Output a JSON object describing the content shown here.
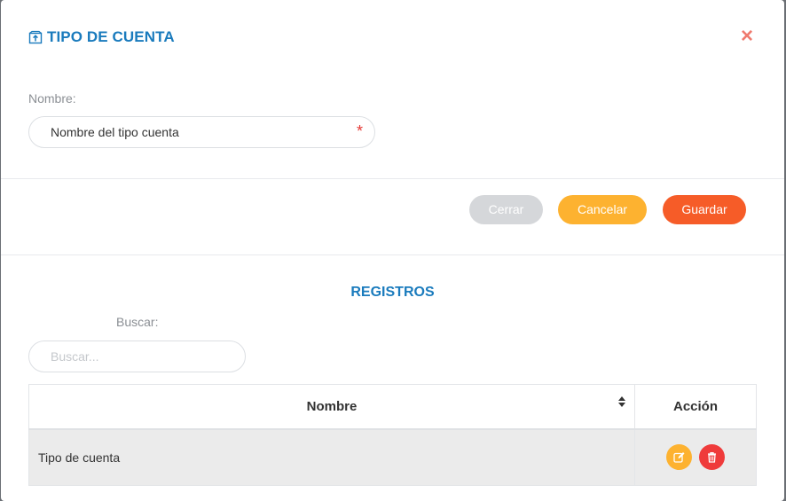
{
  "modal": {
    "title": "TIPO DE CUENTA",
    "close_glyph": "×"
  },
  "form": {
    "name_label": "Nombre:",
    "name_value": "Nombre del tipo cuenta",
    "required_mark": "*"
  },
  "buttons": {
    "close": "Cerrar",
    "cancel": "Cancelar",
    "save": "Guardar"
  },
  "records": {
    "title": "REGISTROS",
    "search_label": "Buscar:",
    "search_placeholder": "Buscar...",
    "columns": [
      "Nombre",
      "Acción"
    ],
    "rows": [
      {
        "name": "Tipo de cuenta"
      }
    ]
  },
  "icons": {
    "header": "upload-box-icon",
    "close": "close-icon",
    "sort": "sort-icon",
    "edit": "edit-icon",
    "delete": "trash-icon"
  },
  "colors": {
    "title_blue": "#1a7bbd",
    "close_red": "#ef7a6e",
    "btn_close": "#d5d7da",
    "btn_cancel": "#fdb230",
    "btn_save": "#f65c28",
    "action_delete": "#ef3b3b"
  }
}
